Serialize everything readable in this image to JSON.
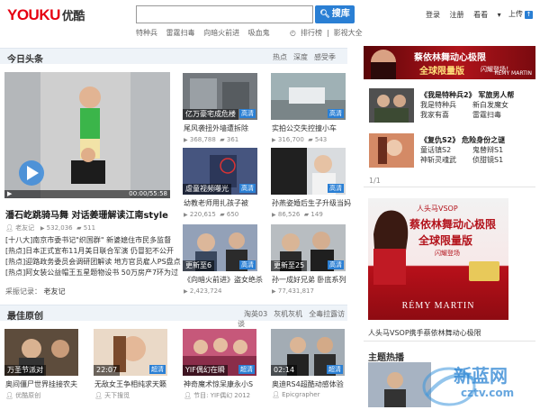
{
  "header": {
    "logo_part1": "YOU",
    "logo_part2": "KU",
    "logo_part3": "优酷",
    "search_value": "",
    "search_button": "搜库",
    "hot_words": [
      "特种兵",
      "雷霆扫毒",
      "向暗火前进",
      "吸血鬼"
    ],
    "rank_label": "排行榜",
    "film_label": "影视大全",
    "links": [
      "登录",
      "注册",
      "看看"
    ],
    "upload_label": "上传"
  },
  "today": {
    "title": "今日头条",
    "tabs": [
      "热点",
      "深度",
      "感受季"
    ],
    "featured": {
      "time": "00:00/55:58",
      "title": "潘石屹跳骑马舞 对话姜珊解读江南style",
      "uploader": "老友记",
      "plays": "532,036",
      "comments": "511",
      "bullets": [
        "[十八大]南京市委书记\"织国群\" 新婆媳住市民多监督",
        "[热点]日本正式宣布11月美日联合军演 仍冒犯不公开",
        "[热点]迎路政务委员会调研团解读 地方官员雇人PS盘点",
        "[热点]阿女装公益帽王五星题物设书 50万房产7环为过"
      ],
      "recommender_label": "采振记录：",
      "recommender": "老友记"
    },
    "videos": [
      {
        "caption": "亿万豪宅成危楼",
        "badge": "高清",
        "title": "尾风袭扭外墙遭拆除",
        "plays": "368,788",
        "comments": "361"
      },
      {
        "caption": "",
        "badge": "高清",
        "title": "实拍公交失控撞小车",
        "plays": "316,700",
        "comments": "543"
      },
      {
        "caption": "虐童视频曝光",
        "badge": "高清",
        "title": "幼教老师用扎孩子被",
        "plays": "220,615",
        "comments": "650"
      },
      {
        "caption": "",
        "badge": "高清",
        "title": "孙燕姿婚后生子升级当妈",
        "plays": "86,526",
        "comments": "149"
      },
      {
        "caption": "更新至6",
        "badge": "高清",
        "title": "《向暗火前进》盗女绝杀",
        "plays": "2,423,724",
        "comments": ""
      },
      {
        "caption": "更新至25",
        "badge": "高清",
        "title": "孙一成好兄弟 卧底系列",
        "plays": "77,431,817",
        "comments": ""
      }
    ]
  },
  "original": {
    "title": "最佳原创",
    "tabs": [
      "淘英03",
      "灰机灰机",
      "全毒拉露访谈"
    ],
    "videos": [
      {
        "caption": "万圣节派对",
        "badge": "",
        "title": "奥间僵尸世界挂接农夫",
        "uploader": "优酷原创"
      },
      {
        "caption": "22:07",
        "badge": "超清",
        "title": "无敌女王争相纯求天籁",
        "uploader": "天下搜觅"
      },
      {
        "caption": "YIF偶幻在瞬",
        "badge": "超清",
        "title": "神奇魔术惊呆康永小S",
        "uploader": "节目: YIF偶幻 2012"
      },
      {
        "caption": "02:14",
        "badge": "超清",
        "title": "奥迪RS4超酷动感体验",
        "uploader": "Epicgrapher"
      }
    ]
  },
  "right": {
    "ad_top": {
      "line1": "蔡依林舞动心极限",
      "line2": "全球限量版",
      "line3": "闪耀登场！"
    },
    "news": [
      {
        "title": "《我是特种兵2》 军旅男人帮",
        "items": [
          "我是特种兵",
          "新白发魔女",
          "我家有喜",
          "雷霆扫毒"
        ]
      },
      {
        "title": "《复仇S2》 危险身份之谜",
        "items": [
          "童话镇S2",
          "鬼替辩S1",
          "神斩灵魂武",
          "侦甜镜S1"
        ]
      }
    ],
    "pager": "1/1",
    "ad_big": {
      "line1": "人头马VSOP",
      "line2": "蔡依林舞动心极限",
      "line3": "全球限量版",
      "line4": "闪耀登场",
      "brand": "RÉMY MARTIN"
    },
    "ad_caption": "人头马VSOP携手蔡依林舞动心极限",
    "theme_title": "主题热播"
  },
  "watermark": {
    "text": "新蓝网",
    "sub": "cztv.com"
  },
  "colors": {
    "accent": "#2a7fd4",
    "brand_red": "#e60012",
    "header_bg": "#eef3f8"
  }
}
